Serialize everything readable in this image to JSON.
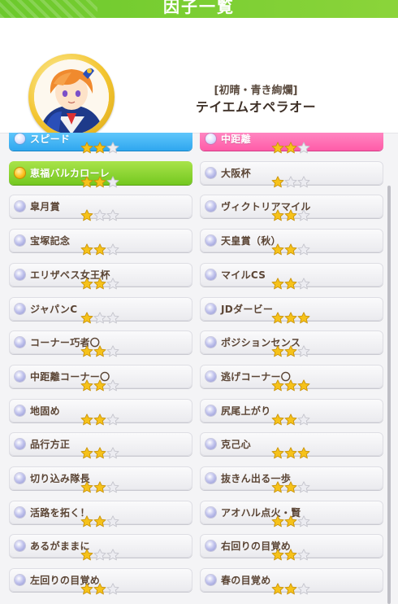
{
  "header": {
    "title": "因子一覧",
    "chara_title": "[初晴・青き絢爛]",
    "chara_name": "テイエムオペラオー"
  },
  "colors": {
    "accent_green": "#74c820",
    "blue_factor": "#2fa7ef",
    "pink_factor": "#ff5ca8",
    "star_filled": "#f6c21a",
    "star_empty": "#e9e9ee"
  },
  "factors_left": [
    {
      "label": "スピード",
      "stars": 2,
      "kind": "blue"
    },
    {
      "label": "恵福バルカローレ",
      "stars": 2,
      "kind": "green"
    },
    {
      "label": "皐月賞",
      "stars": 1,
      "kind": "white"
    },
    {
      "label": "宝塚記念",
      "stars": 2,
      "kind": "white"
    },
    {
      "label": "エリザベス女王杯",
      "stars": 2,
      "kind": "white"
    },
    {
      "label": "ジャパンC",
      "stars": 1,
      "kind": "white"
    },
    {
      "label": "コーナー巧者〇",
      "stars": 2,
      "kind": "white"
    },
    {
      "label": "中距離コーナー〇",
      "stars": 2,
      "kind": "white"
    },
    {
      "label": "地固め",
      "stars": 2,
      "kind": "white"
    },
    {
      "label": "品行方正",
      "stars": 2,
      "kind": "white"
    },
    {
      "label": "切り込み隊長",
      "stars": 2,
      "kind": "white"
    },
    {
      "label": "活路を拓く！",
      "stars": 2,
      "kind": "white"
    },
    {
      "label": "あるがままに",
      "stars": 1,
      "kind": "white"
    },
    {
      "label": "左回りの目覚め",
      "stars": 2,
      "kind": "white"
    }
  ],
  "factors_right": [
    {
      "label": "中距離",
      "stars": 2,
      "kind": "pink"
    },
    {
      "label": "大阪杯",
      "stars": 1,
      "kind": "white"
    },
    {
      "label": "ヴィクトリアマイル",
      "stars": 2,
      "kind": "white"
    },
    {
      "label": "天皇賞（秋）",
      "stars": 2,
      "kind": "white"
    },
    {
      "label": "マイルCS",
      "stars": 2,
      "kind": "white"
    },
    {
      "label": "JDダービー",
      "stars": 3,
      "kind": "white"
    },
    {
      "label": "ポジションセンス",
      "stars": 2,
      "kind": "white"
    },
    {
      "label": "逃げコーナー〇",
      "stars": 3,
      "kind": "white"
    },
    {
      "label": "尻尾上がり",
      "stars": 2,
      "kind": "white"
    },
    {
      "label": "克己心",
      "stars": 3,
      "kind": "white"
    },
    {
      "label": "抜きん出る一歩",
      "stars": 2,
      "kind": "white"
    },
    {
      "label": "アオハル点火・賢",
      "stars": 2,
      "kind": "white"
    },
    {
      "label": "右回りの目覚め",
      "stars": 2,
      "kind": "white"
    },
    {
      "label": "春の目覚め",
      "stars": 2,
      "kind": "white"
    }
  ]
}
